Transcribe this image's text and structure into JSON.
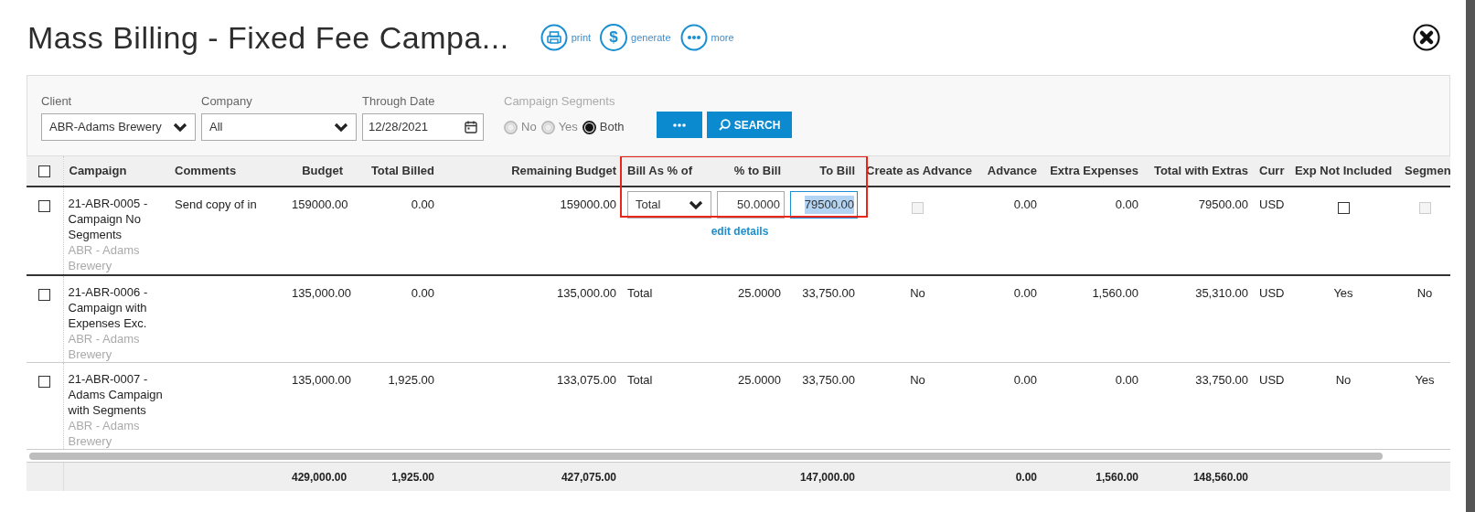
{
  "title": "Mass Billing - Fixed Fee Campa...",
  "actions": [
    {
      "kind": "print",
      "label": "print"
    },
    {
      "kind": "glyph",
      "glyph": "$",
      "label": "generate"
    },
    {
      "kind": "more",
      "label": "more"
    }
  ],
  "filters": {
    "client": {
      "label": "Client",
      "value": "ABR-Adams Brewery"
    },
    "company": {
      "label": "Company",
      "value": "All"
    },
    "through_date": {
      "label": "Through Date",
      "value": "12/28/2021"
    },
    "campaign_segments": {
      "label": "Campaign Segments",
      "options": [
        {
          "label": "No",
          "selected": false
        },
        {
          "label": "Yes",
          "selected": false
        },
        {
          "label": "Both",
          "selected": true
        }
      ]
    },
    "search_button": "SEARCH"
  },
  "table": {
    "select_all": false,
    "columns": [
      {
        "label": "Campaign",
        "highlighted": false
      },
      {
        "label": "Comments",
        "highlighted": false
      },
      {
        "label": "Budget",
        "highlighted": false
      },
      {
        "label": "Total Billed",
        "highlighted": false
      },
      {
        "label": "Remaining Budget",
        "highlighted": false
      },
      {
        "label": "Bill As % of",
        "highlighted": true
      },
      {
        "label": "% to Bill",
        "highlighted": true
      },
      {
        "label": "To Bill",
        "highlighted": true
      },
      {
        "label": "Create as Advance",
        "highlighted": false
      },
      {
        "label": "Advance",
        "highlighted": false
      },
      {
        "label": "Extra Expenses",
        "highlighted": false
      },
      {
        "label": "Total with Extras",
        "highlighted": false
      },
      {
        "label": "Curr",
        "highlighted": false
      },
      {
        "label": "Exp Not Included",
        "highlighted": false
      },
      {
        "label": "Segmen",
        "highlighted": false
      }
    ],
    "rows": [
      {
        "kind": "edit",
        "checked": false,
        "campaign": "21-ABR-0005 - Campaign No Segments",
        "client": "ABR - Adams Brewery",
        "comments": "Send copy of in",
        "budget": "159000.00",
        "total_billed": "0.00",
        "remaining_budget": "159000.00",
        "bill_as": "Total",
        "pct_to_bill": "50.0000",
        "to_bill": "79500.00",
        "to_bill_focused": true,
        "edit_link": "edit details",
        "create_as_advance": {
          "checked": false,
          "disabled": true
        },
        "advance": "0.00",
        "extra_expenses": "0.00",
        "total_with_extras": "79500.00",
        "curr": "USD",
        "exp_not_included": {
          "checked": false,
          "disabled": false
        },
        "segments": {
          "checked": false,
          "disabled": true
        }
      },
      {
        "kind": "view",
        "checked": false,
        "campaign": "21-ABR-0006 - Campaign with Expenses Exc.",
        "client": "ABR - Adams Brewery",
        "budget": "135,000.00",
        "total_billed": "0.00",
        "remaining_budget": "135,000.00",
        "bill_as": "Total",
        "pct_to_bill": "25.0000",
        "to_bill": "33,750.00",
        "create_as_advance": "No",
        "advance": "0.00",
        "extra_expenses": "1,560.00",
        "total_with_extras": "35,310.00",
        "curr": "USD",
        "exp_not_included": "Yes",
        "segments": "No"
      },
      {
        "kind": "view",
        "checked": false,
        "campaign": "21-ABR-0007 - Adams Campaign with Segments",
        "client": "ABR - Adams Brewery",
        "budget": "135,000.00",
        "total_billed": "1,925.00",
        "remaining_budget": "133,075.00",
        "bill_as": "Total",
        "pct_to_bill": "25.0000",
        "to_bill": "33,750.00",
        "create_as_advance": "No",
        "advance": "0.00",
        "extra_expenses": "0.00",
        "total_with_extras": "33,750.00",
        "curr": "USD",
        "exp_not_included": "No",
        "segments": "Yes"
      }
    ],
    "totals": {
      "budget": "429,000.00",
      "total_billed": "1,925.00",
      "remaining_budget": "427,075.00",
      "to_bill": "147,000.00",
      "advance": "0.00",
      "extra_expenses": "1,560.00",
      "total_with_extras": "148,560.00"
    }
  }
}
